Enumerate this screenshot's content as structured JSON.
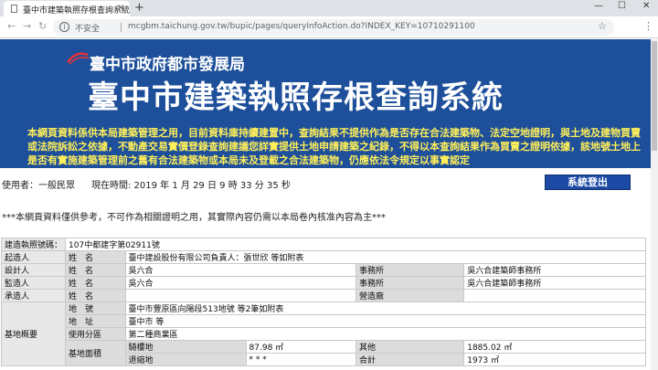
{
  "browser": {
    "tab_title": "臺中市建築執照存根查詢系統",
    "tab_close": "×",
    "new_tab": "+",
    "win_min": "—",
    "win_max": "☐",
    "win_close": "✕",
    "insecure_label": "不安全",
    "url": "mcgbm.taichung.gov.tw/bupic/pages/queryInfoAction.do?INDEX_KEY=10710291100"
  },
  "banner": {
    "department": "臺中市政府都市發展局",
    "system_name": "臺中市建築執照存根查詢系統",
    "notice": "本網頁資料係供本局建築管理之用，目前資料庫持續建置中，查詢結果不提供作為是否存在合法建築物、法定空地證明，與土地及建物買賣或法院訴訟之依據，不動產交易實價登錄查詢建議您詳實提供土地申請建築之紀錄，不得以本查詢結果作為買賣之證明依據，該地號土地上是否有實施建築管理前之舊有合法建築物或本局未及登載之合法建築物，仍應依法令規定以事實認定",
    "colors": {
      "background": "#1d4f9a",
      "notice_text": "#ffef5a"
    }
  },
  "status": {
    "user": "使用者：一般民眾",
    "time": "現在時間: 2019 年 1 月 29 日 9 時 33 分 35 秒",
    "logout_label": "系統登出"
  },
  "disclaimer": "***本網頁資料僅供參考，不可作為相關證明之用，其實際內容仍需以本局卷內核准內容為主***",
  "permit": {
    "permit_no_label": "建造執照號碼：",
    "permit_no": "107中都建字第02911號",
    "name_label": "姓　名",
    "office_label": "事務所",
    "reg_label": "營造廠",
    "applicant_label": "起造人",
    "applicant": "臺中建設股份有限公司負責人：張世欣 等如附表",
    "designer_label": "設計人",
    "designer": "吳六合",
    "designer_office": "吳六合建築師事務所",
    "supervisor_label": "監造人",
    "supervisor": "吳六合",
    "supervisor_office": "吳六合建築師事務所",
    "contractor_label": "承造人",
    "site_label": "基地概要",
    "lot_label": "地　號",
    "lot": "臺中市豐原區向陽段513地號 等2筆如附表",
    "addr_label": "地　址",
    "addr": "臺中市 等",
    "zone_label": "使用分區",
    "zone": "第二種商業區",
    "area_label": "基地面積",
    "building_label": "騎樓地",
    "building_area": "87.98 ㎡",
    "other_label": "其他",
    "other_area": "1885.02 ㎡",
    "setback_label": "退縮地",
    "setback_area": "* * *",
    "total_label": "合計",
    "total_area": "1973 ㎡"
  }
}
